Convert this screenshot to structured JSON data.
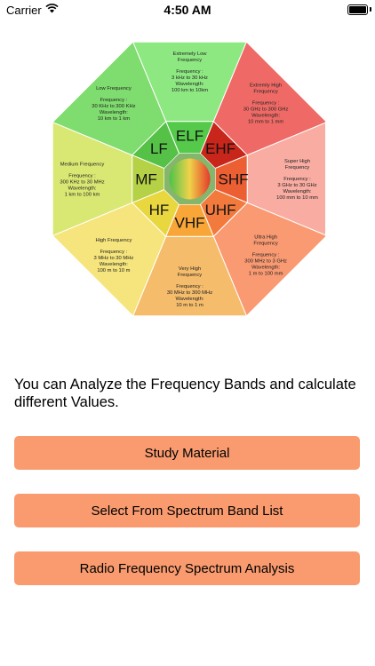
{
  "status_bar": {
    "carrier": "Carrier",
    "time": "4:50 AM"
  },
  "bands": [
    {
      "abbr": "ELF",
      "name": "Extremely Low Frequency",
      "freq_label": "Frequency :",
      "freq": "3 kHz to 30 kHz",
      "wave_label": "Wavelength:",
      "wave": "100 km to 10km",
      "outer_color": "#8ee882",
      "inner_color": "#55c94a"
    },
    {
      "abbr": "EHF",
      "name": "Extremly High Frequency",
      "freq_label": "Frequency :",
      "freq": "30 GHz to 300 GHz",
      "wave_label": "Wavelength:",
      "wave": "10 mm to 1 mm",
      "outer_color": "#ef6a66",
      "inner_color": "#c8261b"
    },
    {
      "abbr": "SHF",
      "name": "Super High Frequency",
      "freq_label": "Frequency :",
      "freq": "3 GHz to 30 GHz",
      "wave_label": "Wavelength:",
      "wave": "100 mm to 10 mm",
      "outer_color": "#f8aca2",
      "inner_color": "#ec5f33"
    },
    {
      "abbr": "UHF",
      "name": "Ultra High Frequency",
      "freq_label": "Frequency :",
      "freq": "300 MHz to 3 GHz",
      "wave_label": "Wavelength:",
      "wave": "1 m to 100 mm",
      "outer_color": "#f99a72",
      "inner_color": "#f27a3d"
    },
    {
      "abbr": "VHF",
      "name": "Very High Frequency",
      "freq_label": "Frequency :",
      "freq": "30 MHz to 300 MHz",
      "wave_label": "Wavelength:",
      "wave": "10 m to 1 m",
      "outer_color": "#f5bc6c",
      "inner_color": "#f8a638"
    },
    {
      "abbr": "HF",
      "name": "High Frequency",
      "freq_label": "Frequency :",
      "freq": "3 MHz to 30 MHz",
      "wave_label": "Wavelength:",
      "wave": "100 m to 10 m",
      "outer_color": "#f6e57c",
      "inner_color": "#e9d73f"
    },
    {
      "abbr": "MF",
      "name": "Medium Frequency",
      "freq_label": "Frequency :",
      "freq": "300 KHz to 30 MHz",
      "wave_label": "Wavelength:",
      "wave": "1 km to 100 km",
      "outer_color": "#d9e873",
      "inner_color": "#b5d146"
    },
    {
      "abbr": "LF",
      "name": "Low Frequency",
      "freq_label": "Frequency :",
      "freq": "30 KHz to 300 KHz",
      "wave_label": "Wavelength:",
      "wave": "10 km to 1 km",
      "outer_color": "#7fdc6e",
      "inner_color": "#55c247"
    }
  ],
  "intro_text": "You can Analyze the Frequency Bands and calculate different Values.",
  "buttons": {
    "study_material": "Study Material",
    "spectrum_band_list": "Select From Spectrum Band List",
    "spectrum_analysis": "Radio Frequency Spectrum Analysis"
  }
}
